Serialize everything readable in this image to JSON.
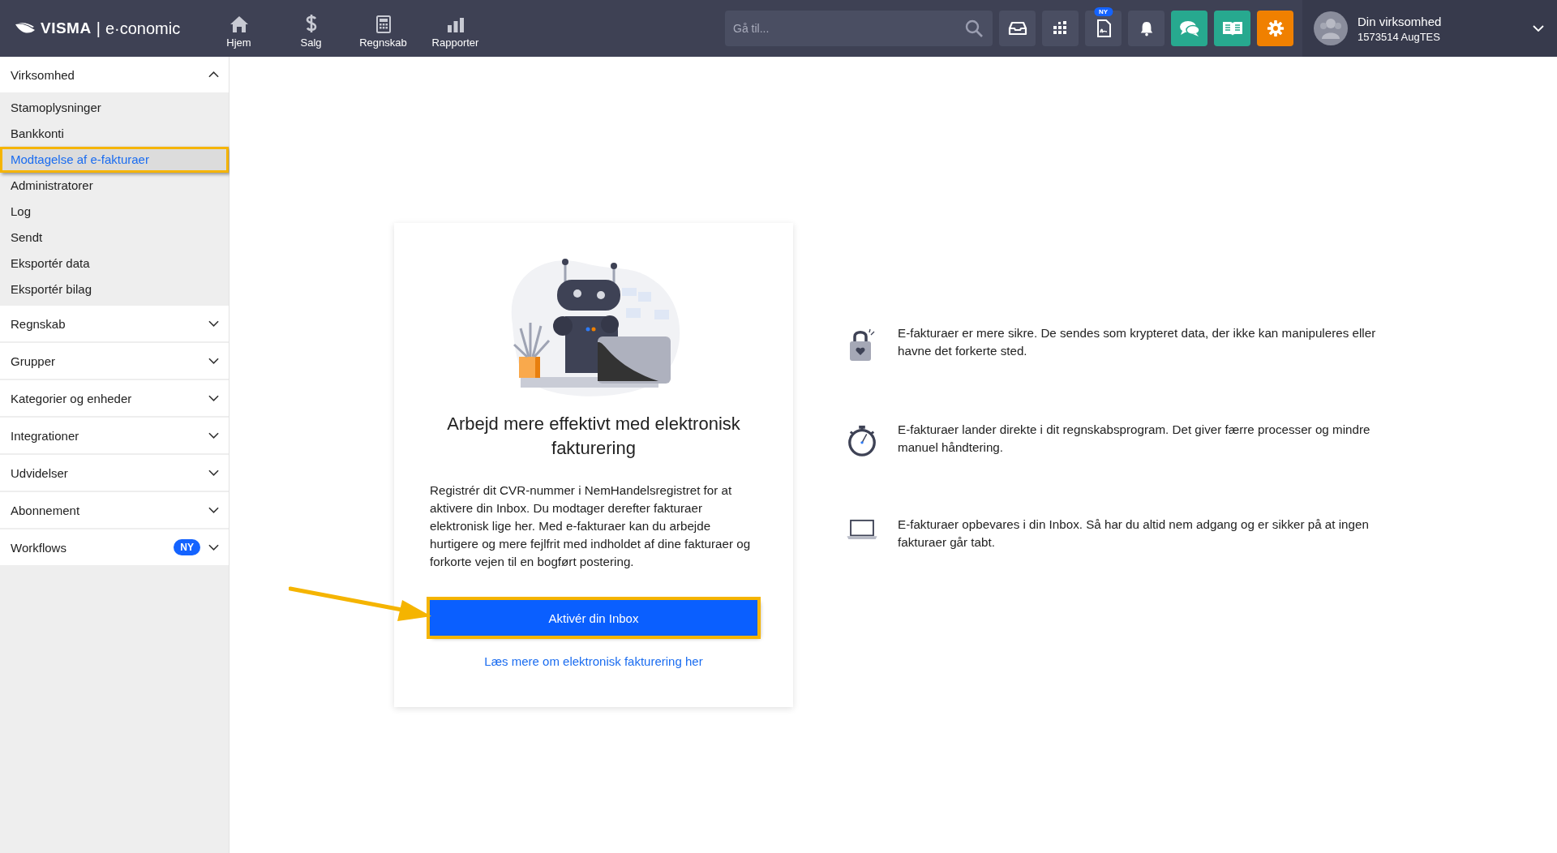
{
  "topbar": {
    "logo": {
      "brand": "VISMA",
      "separator": "|",
      "product": "e·conomic"
    },
    "nav": [
      {
        "label": "Hjem",
        "kind": "home"
      },
      {
        "label": "Salg",
        "kind": "dollar"
      },
      {
        "label": "Regnskab",
        "kind": "calculator"
      },
      {
        "label": "Rapporter",
        "kind": "bars"
      }
    ],
    "search": {
      "placeholder": "Gå til..."
    },
    "tools": [
      {
        "kind": "inbox",
        "color": "#4a4e62"
      },
      {
        "kind": "apps",
        "color": "#4a4e62"
      },
      {
        "kind": "document",
        "color": "#4a4e62",
        "badge": "NY"
      },
      {
        "kind": "bell",
        "color": "#4a4e62"
      },
      {
        "kind": "chat",
        "color": "#27a98f"
      },
      {
        "kind": "book",
        "color": "#27a98f"
      },
      {
        "kind": "gear",
        "color": "#f08000"
      }
    ],
    "account": {
      "name": "Din virksomhed",
      "id": "1573514 AugTES"
    }
  },
  "sidebar": {
    "sections": [
      {
        "label": "Virksomhed",
        "expanded": true,
        "children": [
          {
            "label": "Stamoplysninger",
            "selected": false,
            "highlighted": false
          },
          {
            "label": "Bankkonti",
            "selected": false,
            "highlighted": false
          },
          {
            "label": "Modtagelse af e-fakturaer",
            "selected": true,
            "highlighted": true
          },
          {
            "label": "Administratorer",
            "selected": false,
            "highlighted": false
          },
          {
            "label": "Log",
            "selected": false,
            "highlighted": false
          },
          {
            "label": "Sendt",
            "selected": false,
            "highlighted": false
          },
          {
            "label": "Eksportér data",
            "selected": false,
            "highlighted": false
          },
          {
            "label": "Eksportér bilag",
            "selected": false,
            "highlighted": false
          }
        ]
      },
      {
        "label": "Regnskab",
        "expanded": false
      },
      {
        "label": "Grupper",
        "expanded": false
      },
      {
        "label": "Kategorier og enheder",
        "expanded": false
      },
      {
        "label": "Integrationer",
        "expanded": false
      },
      {
        "label": "Udvidelser",
        "expanded": false
      },
      {
        "label": "Abonnement",
        "expanded": false
      },
      {
        "label": "Workflows",
        "expanded": false,
        "badge": "NY"
      }
    ]
  },
  "card": {
    "title": "Arbejd mere effektivt med elektronisk fakturering",
    "body": "Registrér dit CVR-nummer i NemHandelsregistret for at aktivere din Inbox. Du modtager derefter fakturaer elektronisk lige her. Med e-fakturaer kan du arbejde hurtigere og mere fejlfrit med indholdet af dine fakturaer og forkorte vejen til en bogført postering.",
    "button": {
      "label": "Aktivér din Inbox",
      "highlighted": true
    },
    "link": "Læs mere om elektronisk fakturering her"
  },
  "benefits": [
    {
      "kind": "lock",
      "text": "E-fakturaer er mere sikre. De sendes som krypteret data, der ikke kan manipuleres eller havne det forkerte sted."
    },
    {
      "kind": "stopwatch",
      "text": "E-fakturaer lander direkte i dit regnskabsprogram. Det giver færre processer og mindre manuel håndtering."
    },
    {
      "kind": "laptop",
      "text": "E-fakturaer opbevares i din Inbox. Så har du altid nem adgang og er sikker på at ingen fakturaer går tabt."
    }
  ]
}
